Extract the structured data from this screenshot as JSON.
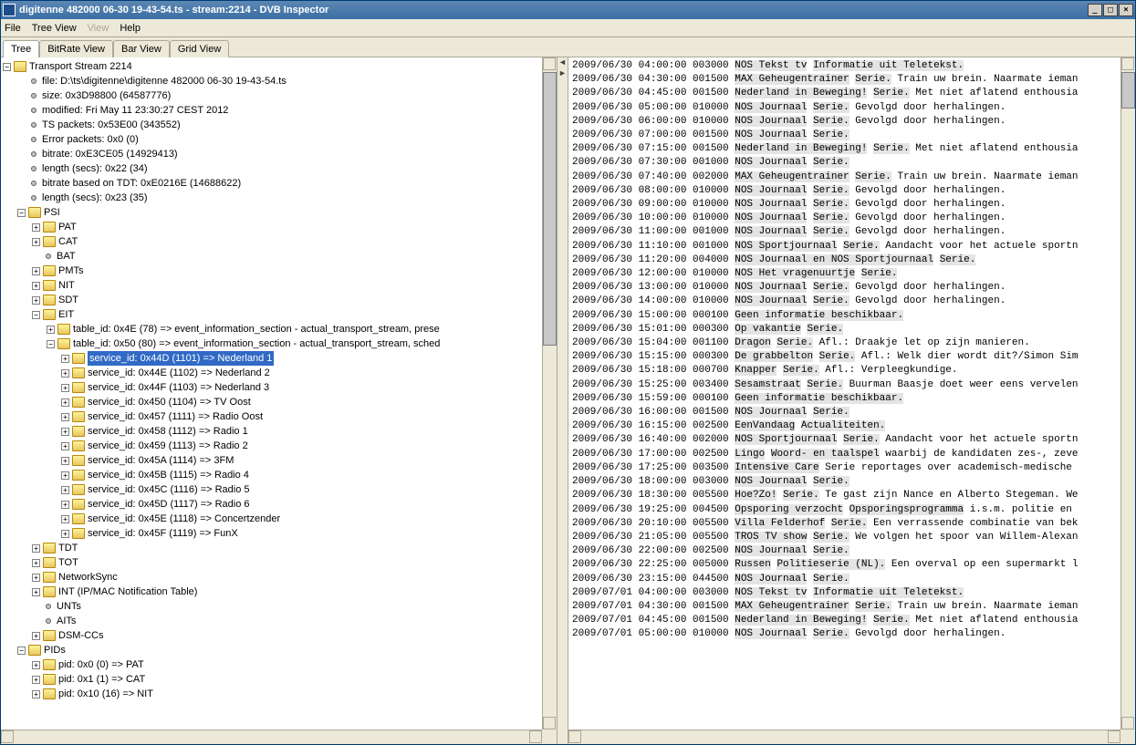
{
  "window": {
    "title": "digitenne 482000 06-30 19-43-54.ts - stream:2214 - DVB Inspector"
  },
  "menu": {
    "file": "File",
    "treeview": "Tree View",
    "view": "View",
    "help": "Help"
  },
  "tabs": {
    "tree": "Tree",
    "bitrate": "BitRate View",
    "bar": "Bar View",
    "grid": "Grid View"
  },
  "tree": {
    "root": "Transport Stream 2214",
    "file": "file: D:\\ts\\digitenne\\digitenne 482000 06-30 19-43-54.ts",
    "size": "size: 0x3D98800 (64587776)",
    "modified": "modified: Fri May 11 23:30:27 CEST 2012",
    "tsp": "TS packets: 0x53E00 (343552)",
    "err": "Error packets: 0x0 (0)",
    "bitrate": "bitrate: 0xE3CE05 (14929413)",
    "len1": "length (secs): 0x22 (34)",
    "bitrate_tdt": "bitrate based on TDT: 0xE0216E (14688622)",
    "len2": "length (secs): 0x23 (35)",
    "psi": "PSI",
    "pat": "PAT",
    "cat": "CAT",
    "bat": "BAT",
    "pmts": "PMTs",
    "nit": "NIT",
    "sdt": "SDT",
    "eit": "EIT",
    "tbl4e": "table_id: 0x4E (78) => event_information_section - actual_transport_stream, prese",
    "tbl50": "table_id: 0x50 (80) => event_information_section - actual_transport_stream, sched",
    "svc": [
      "service_id: 0x44D (1101) => Nederland 1",
      "service_id: 0x44E (1102) => Nederland 2",
      "service_id: 0x44F (1103) => Nederland 3",
      "service_id: 0x450 (1104) => TV Oost",
      "service_id: 0x457 (1111) => Radio Oost",
      "service_id: 0x458 (1112) => Radio 1",
      "service_id: 0x459 (1113) => Radio 2",
      "service_id: 0x45A (1114) => 3FM",
      "service_id: 0x45B (1115) => Radio 4",
      "service_id: 0x45C (1116) => Radio 5",
      "service_id: 0x45D (1117) => Radio 6",
      "service_id: 0x45E (1118) => Concertzender",
      "service_id: 0x45F (1119) => FunX"
    ],
    "tdt": "TDT",
    "tot": "TOT",
    "netsync": "NetworkSync",
    "int": "INT (IP/MAC Notification Table)",
    "unts": "UNTs",
    "aits": "AITs",
    "dsmccs": "DSM-CCs",
    "pids": "PIDs",
    "pid0": "pid: 0x0 (0) => PAT",
    "pid1": "pid: 0x1 (1) => CAT",
    "pid10": "pid: 0x10 (16) => NIT"
  },
  "events": [
    {
      "t": "2009/06/30 04:00:00 003000",
      "n": "NOS Tekst tv",
      "d": "Informatie uit Teletekst."
    },
    {
      "t": "2009/06/30 04:30:00 001500",
      "n": "MAX Geheugentrainer",
      "d": "Serie. Train uw brein. Naarmate ieman"
    },
    {
      "t": "2009/06/30 04:45:00 001500",
      "n": "Nederland in Beweging!",
      "d": "Serie. Met niet aflatend enthousia"
    },
    {
      "t": "2009/06/30 05:00:00 010000",
      "n": "NOS Journaal",
      "d": "Serie. Gevolgd door herhalingen."
    },
    {
      "t": "2009/06/30 06:00:00 010000",
      "n": "NOS Journaal",
      "d": "Serie. Gevolgd door herhalingen."
    },
    {
      "t": "2009/06/30 07:00:00 001500",
      "n": "NOS Journaal",
      "d": "Serie."
    },
    {
      "t": "2009/06/30 07:15:00 001500",
      "n": "Nederland in Beweging!",
      "d": "Serie. Met niet aflatend enthousia"
    },
    {
      "t": "2009/06/30 07:30:00 001000",
      "n": "NOS Journaal",
      "d": "Serie."
    },
    {
      "t": "2009/06/30 07:40:00 002000",
      "n": "MAX Geheugentrainer",
      "d": "Serie. Train uw brein. Naarmate ieman"
    },
    {
      "t": "2009/06/30 08:00:00 010000",
      "n": "NOS Journaal",
      "d": "Serie. Gevolgd door herhalingen."
    },
    {
      "t": "2009/06/30 09:00:00 010000",
      "n": "NOS Journaal",
      "d": "Serie. Gevolgd door herhalingen."
    },
    {
      "t": "2009/06/30 10:00:00 010000",
      "n": "NOS Journaal",
      "d": "Serie. Gevolgd door herhalingen."
    },
    {
      "t": "2009/06/30 11:00:00 001000",
      "n": "NOS Journaal",
      "d": "Serie. Gevolgd door herhalingen."
    },
    {
      "t": "2009/06/30 11:10:00 001000",
      "n": "NOS Sportjournaal",
      "d": "Serie. Aandacht voor het actuele sportn"
    },
    {
      "t": "2009/06/30 11:20:00 004000",
      "n": "NOS Journaal en NOS Sportjournaal",
      "d": "Serie."
    },
    {
      "t": "2009/06/30 12:00:00 010000",
      "n": "NOS Het vragenuurtje",
      "d": "Serie."
    },
    {
      "t": "2009/06/30 13:00:00 010000",
      "n": "NOS Journaal",
      "d": "Serie. Gevolgd door herhalingen."
    },
    {
      "t": "2009/06/30 14:00:00 010000",
      "n": "NOS Journaal",
      "d": "Serie. Gevolgd door herhalingen."
    },
    {
      "t": "2009/06/30 15:00:00 000100",
      "n": "Geen informatie beschikbaar.",
      "d": ""
    },
    {
      "t": "2009/06/30 15:01:00 000300",
      "n": "Op vakantie",
      "d": "Serie."
    },
    {
      "t": "2009/06/30 15:04:00 001100",
      "n": "Dragon",
      "d": "Serie. Afl.: Draakje let op zijn manieren."
    },
    {
      "t": "2009/06/30 15:15:00 000300",
      "n": "De grabbelton",
      "d": "Serie. Afl.: Welk dier wordt dit?/Simon Sim"
    },
    {
      "t": "2009/06/30 15:18:00 000700",
      "n": "Knapper",
      "d": "Serie. Afl.: Verpleegkundige."
    },
    {
      "t": "2009/06/30 15:25:00 003400",
      "n": "Sesamstraat",
      "d": "Serie. Buurman Baasje doet weer eens vervelen"
    },
    {
      "t": "2009/06/30 15:59:00 000100",
      "n": "Geen informatie beschikbaar.",
      "d": ""
    },
    {
      "t": "2009/06/30 16:00:00 001500",
      "n": "NOS Journaal",
      "d": "Serie."
    },
    {
      "t": "2009/06/30 16:15:00 002500",
      "n": "EenVandaag",
      "d": "Actualiteiten."
    },
    {
      "t": "2009/06/30 16:40:00 002000",
      "n": "NOS Sportjournaal",
      "d": "Serie. Aandacht voor het actuele sportn"
    },
    {
      "t": "2009/06/30 17:00:00 002500",
      "n": "Lingo",
      "d": "Woord- en taalspel waarbij de kandidaten zes-, zeve"
    },
    {
      "t": "2009/06/30 17:25:00 003500",
      "n": "Intensive Care",
      "d": "Serie reportages over academisch-medische"
    },
    {
      "t": "2009/06/30 18:00:00 003000",
      "n": "NOS Journaal",
      "d": "Serie."
    },
    {
      "t": "2009/06/30 18:30:00 005500",
      "n": "Hoe?Zo!",
      "d": "Serie. Te gast zijn Nance en Alberto Stegeman. We"
    },
    {
      "t": "2009/06/30 19:25:00 004500",
      "n": "Opsporing verzocht",
      "d": "Opsporingsprogramma i.s.m. politie en"
    },
    {
      "t": "2009/06/30 20:10:00 005500",
      "n": "Villa Felderhof",
      "d": "Serie. Een verrassende combinatie van bek"
    },
    {
      "t": "2009/06/30 21:05:00 005500",
      "n": "TROS TV show",
      "d": "Serie. We volgen het spoor van Willem-Alexan"
    },
    {
      "t": "2009/06/30 22:00:00 002500",
      "n": "NOS Journaal",
      "d": "Serie."
    },
    {
      "t": "2009/06/30 22:25:00 005000",
      "n": "Russen",
      "d": "Politieserie (NL). Een overval op een supermarkt l"
    },
    {
      "t": "2009/06/30 23:15:00 044500",
      "n": "NOS Journaal",
      "d": "Serie."
    },
    {
      "t": "2009/07/01 04:00:00 003000",
      "n": "NOS Tekst tv",
      "d": "Informatie uit Teletekst."
    },
    {
      "t": "2009/07/01 04:30:00 001500",
      "n": "MAX Geheugentrainer",
      "d": "Serie. Train uw brein. Naarmate ieman"
    },
    {
      "t": "2009/07/01 04:45:00 001500",
      "n": "Nederland in Beweging!",
      "d": "Serie. Met niet aflatend enthousia"
    },
    {
      "t": "2009/07/01 05:00:00 010000",
      "n": "NOS Journaal",
      "d": "Serie. Gevolgd door herhalingen."
    }
  ]
}
